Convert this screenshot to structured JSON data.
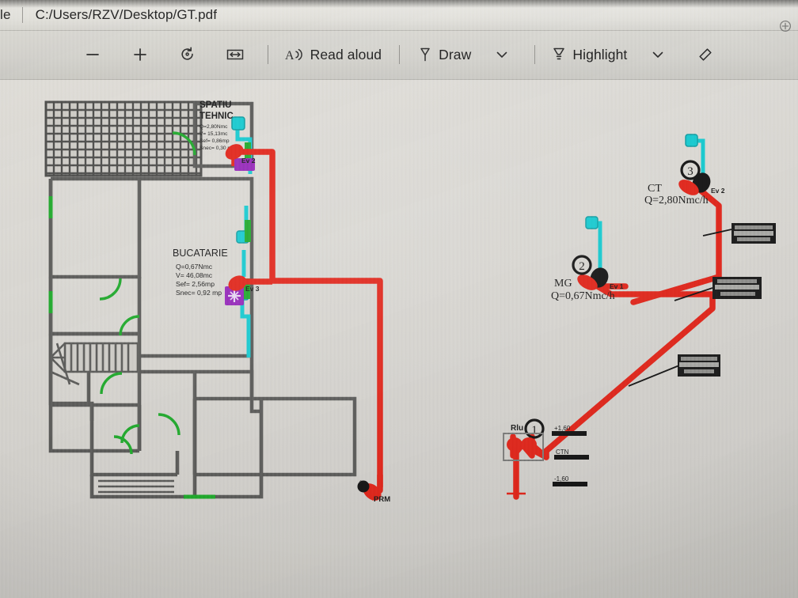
{
  "window": {
    "file_menu_label": "ile",
    "file_path": "C:/Users/RZV/Desktop/GT.pdf"
  },
  "toolbar": {
    "zoom_out_icon": "minus-icon",
    "zoom_in_icon": "plus-icon",
    "rotate_icon": "rotate-icon",
    "fit_width_icon": "fit-to-width-icon",
    "read_aloud_icon": "read-aloud-icon",
    "read_aloud_label": "Read aloud",
    "draw_icon": "pen-icon",
    "draw_label": "Draw",
    "draw_chevron_icon": "chevron-down-icon",
    "highlight_icon": "highlighter-icon",
    "highlight_label": "Highlight",
    "highlight_chevron_icon": "chevron-down-icon",
    "erase_icon": "eraser-icon",
    "corner_icon": "circled-plus-icon"
  },
  "document": {
    "title": "GT.pdf",
    "floorplan": {
      "rooms": [
        {
          "name": "SPATIU",
          "name2": "TEHNIC",
          "specs": [
            "Q=2,80Nmc",
            "V=  15,13mc",
            "Sef= 0,86mp",
            "Snec= 0,30 mp"
          ]
        },
        {
          "name": "BUCATARIE",
          "specs": [
            "Q=0,67Nmc",
            "V=  46,08mc",
            "Sef= 2,56mp",
            "Snec= 0,92 mp"
          ]
        }
      ],
      "markers": [
        {
          "label": "Ev 2"
        },
        {
          "label": "Ev 3"
        }
      ],
      "outlet_label": "PRM"
    },
    "isometric": {
      "nodes": [
        {
          "number": "3",
          "name": "CT",
          "flow": "Q=2,80Nmc/h",
          "valve": "Ev 2"
        },
        {
          "number": "2",
          "name": "MG",
          "flow": "Q=0,67Nmc/h",
          "valve": "Ev 1"
        },
        {
          "number": "1",
          "name": "Rlu",
          "flow": "",
          "valve": ""
        }
      ],
      "levels": [
        "+1,60",
        "CTN",
        "-1,60"
      ],
      "callouts": [
        {
          "lines": [
            "TEAVA OTEL",
            "PROTECTIE ANTICOROZIVA",
            "DN 25"
          ]
        },
        {
          "lines": [
            "TEAVA OTEL",
            "PROTECTIE ANTICOROZIVA",
            "DN 20"
          ]
        },
        {
          "lines": [
            "TEAVA OTEL",
            "PROTECTIE ANTICOROZIVA",
            "DN 20"
          ]
        }
      ]
    }
  },
  "colors": {
    "gas_red": "#e02419",
    "vent_cyan": "#16c9cf",
    "window_green": "#1fa82b",
    "appliance_purple": "#9427b8",
    "wall_gray": "#5a5a58"
  }
}
